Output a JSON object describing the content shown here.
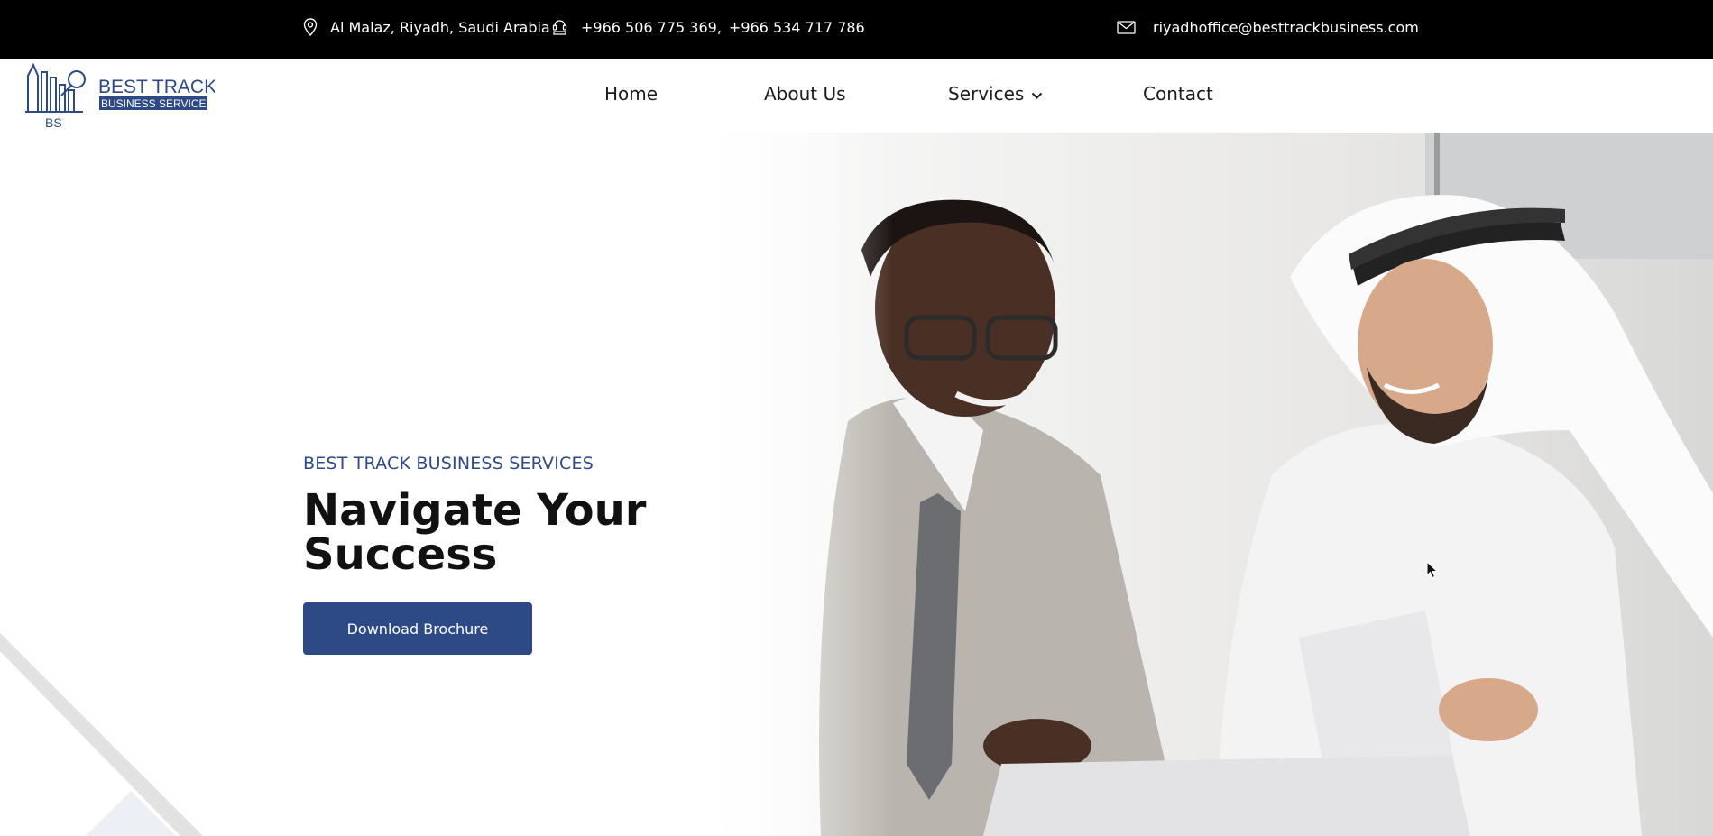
{
  "topbar": {
    "address": "Al Malaz, Riyadh, Saudi Arabia",
    "phone_1": "+966 506 775 369,",
    "phone_2": "+966 534 717 786",
    "email": "riyadhoffice@besttrackbusiness.com"
  },
  "logo": {
    "line1": "BEST TRACK",
    "line2": "BUSINESS SERVICES",
    "initials": "BS"
  },
  "nav": {
    "home": "Home",
    "about": "About Us",
    "services": "Services",
    "contact": "Contact"
  },
  "hero": {
    "eyebrow": "BEST TRACK BUSINESS SERVICES",
    "headline_line1": "Navigate Your",
    "headline_line2": "Success",
    "cta_label": "Download Brochure"
  },
  "icons": {
    "address": "location-pin-icon",
    "phone": "phone-icon",
    "email": "envelope-icon",
    "dropdown": "chevron-down-icon",
    "cursor": "mouse-cursor-icon"
  },
  "colors": {
    "topbar_bg": "#000000",
    "brand_blue": "#2e4a86",
    "text_dark": "#111111"
  }
}
